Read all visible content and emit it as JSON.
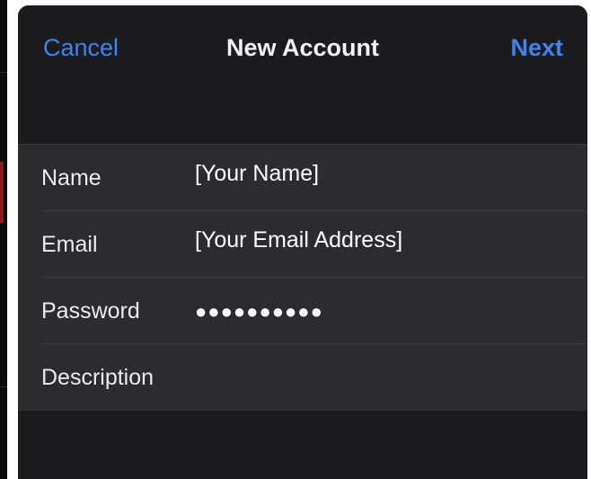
{
  "navbar": {
    "cancel_label": "Cancel",
    "title": "New Account",
    "next_label": "Next"
  },
  "form": {
    "rows": [
      {
        "label": "Name",
        "value": "[Your Name]"
      },
      {
        "label": "Email",
        "value": "[Your Email Address]"
      },
      {
        "label": "Password",
        "value": "●●●●●●●●●●"
      },
      {
        "label": "Description",
        "value": ""
      }
    ]
  },
  "colors": {
    "background": "#1c1c1e",
    "form_background": "#2c2c2e",
    "accent": "#3e84f0",
    "text": "#ffffff"
  }
}
